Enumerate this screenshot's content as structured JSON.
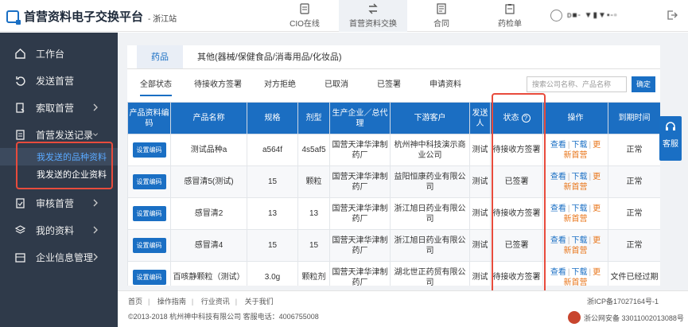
{
  "header": {
    "logo_text": "首营资料电子交换平台",
    "logo_sub": "- 浙江站",
    "nav": [
      {
        "label": "CIO在线",
        "icon": "monitor-icon"
      },
      {
        "label": "首营资料交换",
        "icon": "exchange-icon"
      },
      {
        "label": "合同",
        "icon": "contract-icon"
      },
      {
        "label": "药检单",
        "icon": "inspection-icon"
      }
    ],
    "active_nav": 1,
    "user_name": "ᴅ■- ▼▮▼▪-▫"
  },
  "sidebar": {
    "items": [
      {
        "label": "工作台",
        "icon": "home-icon",
        "expandable": false
      },
      {
        "label": "发送首营",
        "icon": "send-icon",
        "expandable": false
      },
      {
        "label": "索取首营",
        "icon": "request-icon",
        "expandable": true
      },
      {
        "label": "首营发送记录",
        "icon": "record-icon",
        "expandable": true,
        "expanded": true
      },
      {
        "label": "审核首营",
        "icon": "audit-icon",
        "expandable": true
      },
      {
        "label": "我的资料",
        "icon": "layers-icon",
        "expandable": true
      },
      {
        "label": "企业信息管理",
        "icon": "company-icon",
        "expandable": true
      }
    ],
    "sub_items": [
      {
        "label": "我发送的品种资料",
        "active": true
      },
      {
        "label": "我发送的企业资料",
        "active": false
      }
    ]
  },
  "tabs": [
    "药品",
    "其他(器械/保健食品/消毒用品/化妆品)"
  ],
  "filters": [
    "全部状态",
    "待接收方签署",
    "对方拒绝",
    "已取消",
    "已签署",
    "申请资料"
  ],
  "search": {
    "placeholder": "搜索公司名称、产品名称",
    "button": "确定"
  },
  "table": {
    "columns": [
      "产品资料编码",
      "产品名称",
      "规格",
      "剂型",
      "生产企业／总代理",
      "下游客户",
      "发送人",
      "状态",
      "操作",
      "到期时间"
    ],
    "rows": [
      {
        "code_btn": "设置编码",
        "name": "测试品种a",
        "spec": "a564f",
        "form": "4s5af5",
        "maker": "国营天津华津制药厂",
        "customer": "杭州神中科技演示商业公司",
        "sender": "测试",
        "status": "待接收方签署",
        "expire": "正常"
      },
      {
        "code_btn": "设置编码",
        "name": "感冒清5(测试)",
        "spec": "15",
        "form": "颗粒",
        "maker": "国营天津华津制药厂",
        "customer": "益阳恒康药业有限公司",
        "sender": "测试",
        "status": "已签署",
        "expire": "正常"
      },
      {
        "code_btn": "设置编码",
        "name": "感冒清2",
        "spec": "13",
        "form": "13",
        "maker": "国营天津华津制药厂",
        "customer": "浙江旭日药业有限公司",
        "sender": "测试",
        "status": "待接收方签署",
        "expire": "正常"
      },
      {
        "code_btn": "设置编码",
        "name": "感冒清4",
        "spec": "15",
        "form": "15",
        "maker": "国营天津华津制药厂",
        "customer": "浙江旭日药业有限公司",
        "sender": "测试",
        "status": "已签署",
        "expire": "正常"
      },
      {
        "code_btn": "设置编码",
        "name": "百咳静颗粒（测试）",
        "spec": "3.0g",
        "form": "颗粒剂",
        "maker": "国营天津华津制药厂",
        "customer": "湖北世正药贸有限公司",
        "sender": "测试",
        "status": "待接收方签署",
        "expire": "文件已经过期"
      }
    ],
    "ops": {
      "view": "查看",
      "download": "下载",
      "update": "更",
      "new_first": "新首营"
    }
  },
  "customer_service": "客服",
  "footer": {
    "links": [
      "首页",
      "操作指南",
      "行业资讯",
      "关于我们"
    ],
    "copyright": "©2013-2018  杭州神中科技有限公司  客服电话：4006755008",
    "icp": "浙ICP备17027164号-1",
    "police": "浙公网安备 33011002013088号"
  },
  "colors": {
    "primary": "#1b6ec2",
    "sidebar": "#2f3a4a",
    "highlight": "#e84b3c",
    "update": "#e8761b"
  }
}
